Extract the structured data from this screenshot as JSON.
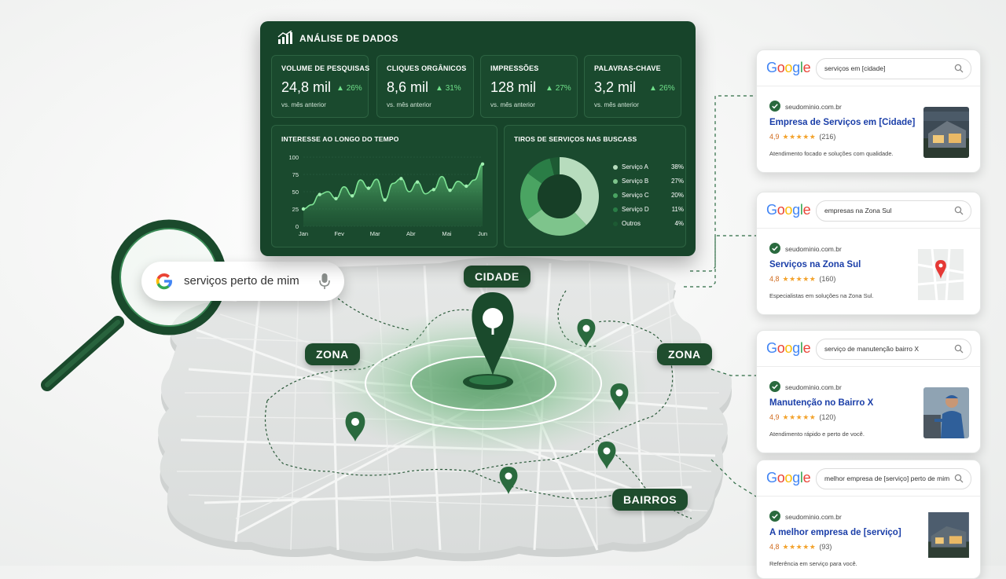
{
  "dashboard": {
    "title": "ANÁLISE DE DADOS",
    "kpis": [
      {
        "label": "VOLUME DE PESQUISAS",
        "value": "24,8 mil",
        "delta": "26%",
        "sub": "vs. mês anterior"
      },
      {
        "label": "CLIQUES ORGÂNICOS",
        "value": "8,6 mil",
        "delta": "31%",
        "sub": "vs. mês anterior"
      },
      {
        "label": "IMPRESSÕES",
        "value": "128 mil",
        "delta": "27%",
        "sub": "vs. mês anterior"
      },
      {
        "label": "PALAVRAS-CHAVE",
        "value": "3,2 mil",
        "delta": "26%",
        "sub": "vs. mês anterior"
      }
    ],
    "accent": "#6fe08a"
  },
  "chart_data": [
    {
      "type": "area",
      "title": "INTERESSE AO LONGO DO TEMPO",
      "x": [
        "Jan",
        "",
        "Fev",
        "",
        "Mar",
        "",
        "Abr",
        "",
        "Mai",
        "",
        "Jun"
      ],
      "values": [
        25,
        31,
        46,
        50,
        40,
        57,
        44,
        67,
        55,
        68,
        38,
        62,
        69,
        50,
        64,
        47,
        53,
        72,
        52,
        65,
        58,
        67,
        90
      ],
      "x_ticks": [
        "Jan",
        "Fev",
        "Mar",
        "Abr",
        "Mai",
        "Jun"
      ],
      "y_ticks": [
        0,
        25,
        50,
        75,
        100
      ],
      "ylim": [
        0,
        100
      ]
    },
    {
      "type": "pie",
      "title": "TIROS DE SERVIÇOS NAS BUSCASS",
      "labels": [
        "Serviço A",
        "Serviço B",
        "Serviço C",
        "Serviço D",
        "Outros"
      ],
      "values": [
        38,
        27,
        20,
        11,
        4
      ],
      "display": [
        "38%",
        "27%",
        "20%",
        "11%",
        "4%"
      ],
      "colors": [
        "#b7dcbd",
        "#7ec48c",
        "#4aa462",
        "#2a7d46",
        "#1d5a33"
      ]
    }
  ],
  "search": {
    "query": "serviços perto de mim"
  },
  "map": {
    "labels": {
      "city": "CIDADE",
      "zone_left": "ZONA",
      "zone_right": "ZONA",
      "neighborhoods": "BAIRROS"
    }
  },
  "serp_cards": [
    {
      "logo": "Google",
      "query": "serviços em [cidade]",
      "domain": "seudominio.com.br",
      "title": "Empresa de Serviços em [Cidade]",
      "rating": "4,9",
      "stars": "★★★★★",
      "count": "(216)",
      "description": "Atendimento focado e soluções com qualidade.",
      "thumb": "house-photo"
    },
    {
      "logo": "Google",
      "query": "empresas na Zona Sul",
      "domain": "seudominio.com.br",
      "title": "Serviços na Zona Sul",
      "rating": "4,8",
      "stars": "★★★★★",
      "count": "(160)",
      "description": "Especialistas em soluções na Zona Sul.",
      "thumb": "map-pin"
    },
    {
      "logo": "Google",
      "query": "serviço de manutenção bairro X",
      "domain": "seudominio.com.br",
      "title": "Manutenção no Bairro X",
      "rating": "4,9",
      "stars": "★★★★★",
      "count": "(120)",
      "description": "Atendimento rápido e perto de você.",
      "thumb": "technician-photo"
    },
    {
      "logo": "Google",
      "query": "melhor empresa de [serviço] perto de mim",
      "domain": "seudominio.com.br",
      "title": "A melhor empresa de [serviço]",
      "rating": "4,8",
      "stars": "★★★★★",
      "count": "(93)",
      "description": "Referência em serviço para você.",
      "thumb": "house-photo"
    }
  ]
}
